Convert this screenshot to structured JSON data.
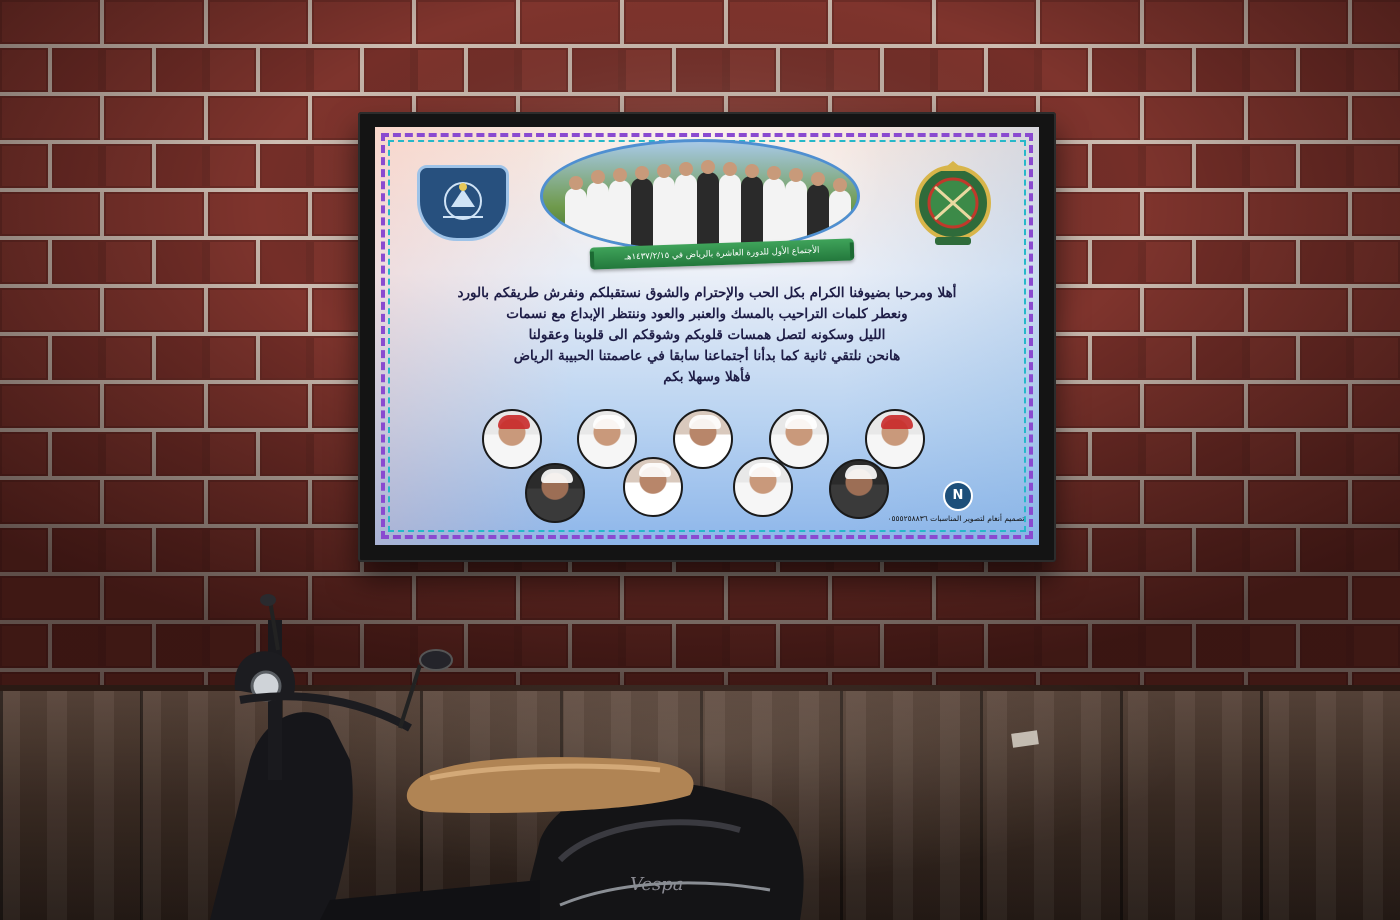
{
  "poster": {
    "ribbon_text": "الأجتماع الأول للدورة العاشرة بالرياض في ١٤٣٧/٢/١٥هـ",
    "message_lines": [
      "أهلا ومرحبا بضيوفنا الكرام بكل الحب والإحترام والشوق نستقبلكم ونفرش طريقكم بالورد",
      "ونعطر كلمات التراحيب بالمسك والعنبر والعود وننتظر الإبداع مع نسمات",
      "الليل وسكونه لتصل همسات قلوبكم وشوقكم الى قلوبنا وعقولنا",
      "هانحن نلتقي ثانية كما بدأنا أجتماعنا سابقا في عاصمتنا الحبيبة الرياض",
      "فأهلا وسهلا بكم"
    ],
    "credit_text": "تصميم أنغام لتصوير المناسبات ٠٥٥٥٢٥٨٨٣٦",
    "credit_logo": "N",
    "colors": {
      "border_purple": "#8a4ad0",
      "border_cyan": "#26b8c9",
      "ribbon_green": "#2f8f4a",
      "text_navy": "#1f1e47"
    },
    "icons": [
      "left-emblem-icon",
      "right-emblem-icon",
      "designer-logo-icon"
    ]
  },
  "scene": {
    "scooter_brand": "Vespa",
    "wall": "red-brick",
    "ground": "wooden-fence"
  }
}
